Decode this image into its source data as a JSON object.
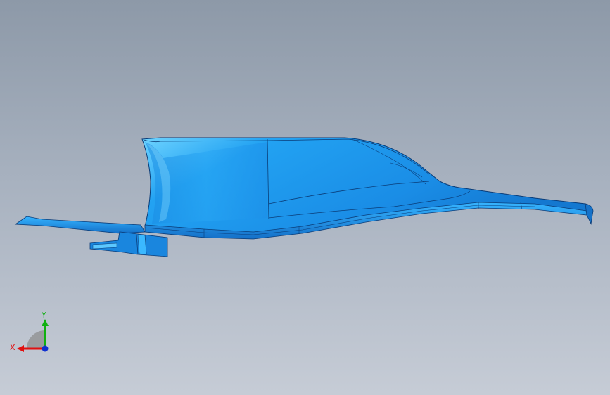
{
  "viewport": {
    "background_top": "#8d99a8",
    "background_bottom": "#c6ccd6"
  },
  "model": {
    "part_color": "#1e8fe8",
    "highlight_color": "#5cc8ff",
    "edge_color": "#0a3c78"
  },
  "triad": {
    "x_label": "X",
    "y_label": "Y",
    "x_color": "#e01010",
    "y_color": "#10b010",
    "z_color": "#1030d0"
  }
}
